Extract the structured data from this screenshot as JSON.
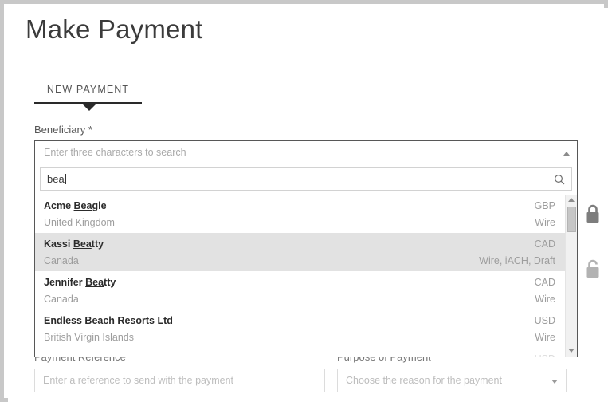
{
  "page": {
    "title": "Make Payment"
  },
  "tabs": [
    {
      "label": "NEW PAYMENT",
      "active": true
    }
  ],
  "form": {
    "beneficiary": {
      "label": "Beneficiary *",
      "combo_placeholder": "Enter three characters to search",
      "search_value": "bea",
      "search_icon": "search-icon",
      "collapse_icon": "chevron-up-icon",
      "results": [
        {
          "name_pre": "Acme ",
          "name_match": "Bea",
          "name_post": "gle",
          "country": "United Kingdom",
          "currency": "GBP",
          "methods": "Wire",
          "selected": false
        },
        {
          "name_pre": "Kassi ",
          "name_match": "Bea",
          "name_post": "tty",
          "country": "Canada",
          "currency": "CAD",
          "methods": "Wire, iACH, Draft",
          "selected": true
        },
        {
          "name_pre": "Jennifer ",
          "name_match": "Bea",
          "name_post": "tty",
          "country": "Canada",
          "currency": "CAD",
          "methods": "Wire",
          "selected": false
        },
        {
          "name_pre": "Endless ",
          "name_match": "Bea",
          "name_post": "ch Resorts Ltd",
          "country": "British Virgin Islands",
          "currency": "USD",
          "methods": "Wire",
          "selected": false
        },
        {
          "name_pre": "",
          "name_match": "",
          "name_post": "",
          "country": "",
          "currency": "USD",
          "methods": "",
          "selected": false
        }
      ]
    },
    "payment_reference": {
      "label": "Payment Reference",
      "placeholder": "Enter a reference to send with the payment",
      "value": ""
    },
    "purpose_of_payment": {
      "label": "Purpose of Payment",
      "placeholder": "Choose the reason for the payment",
      "value": ""
    }
  },
  "status_icons": [
    {
      "name": "lock-closed-icon",
      "state": "locked"
    },
    {
      "name": "lock-open-icon",
      "state": "unlocked"
    }
  ],
  "colors": {
    "tab_active_underline": "#2a2a2a",
    "row_selected_bg": "#e2e2e2",
    "border": "#575757",
    "muted_text": "#9d9d9d",
    "lock_closed": "#7d7d7d",
    "lock_open": "#b2b2b2"
  }
}
